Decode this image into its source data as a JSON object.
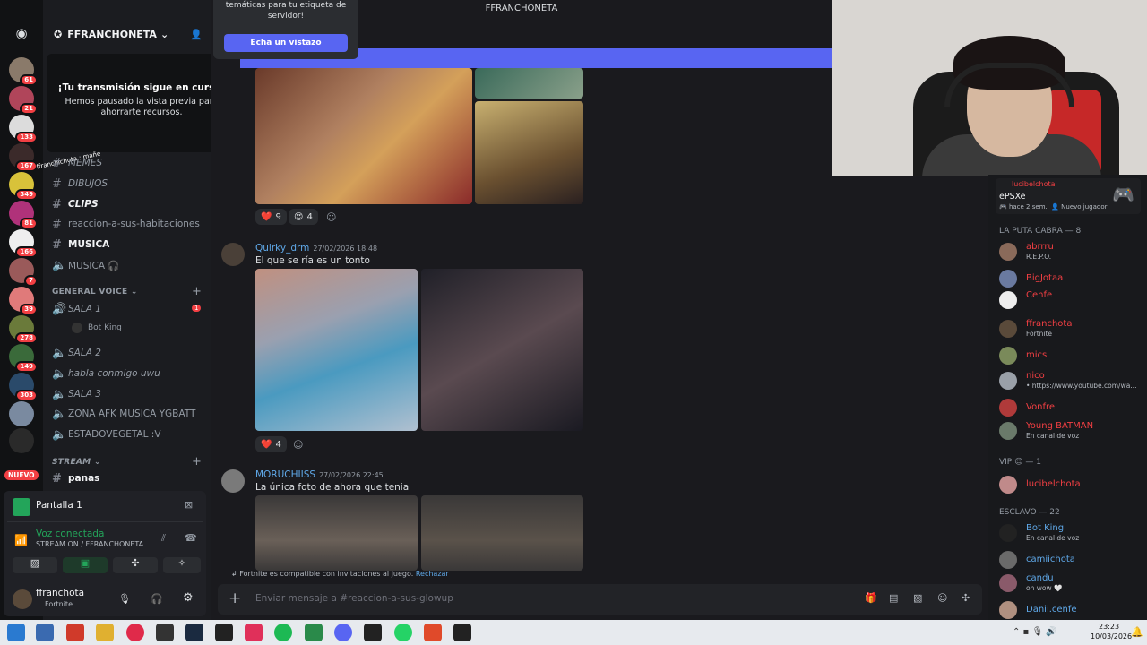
{
  "window": {
    "title": "FFRANCHONETA"
  },
  "server": {
    "name": "FFRANCHONETA"
  },
  "rail_badges": [
    "61",
    "21",
    "133",
    "167",
    "349",
    "81",
    "166",
    "7",
    "39",
    "278",
    "149",
    "303"
  ],
  "rail_new_label": "NUEVO",
  "notice": {
    "title": "¡Tu transmisión sigue en curso!",
    "body": "Hemos pausado la vista previa para ahorrarte recursos."
  },
  "popup": {
    "text": "temáticas para tu etiqueta de servidor!",
    "button": "Echa un vistazo"
  },
  "overlay_text": "ffranchichota : mañe",
  "channels": {
    "memes": "MEMES",
    "dibujos": "DIBUJOS",
    "clips": "CLIPS",
    "reaccion": "reaccion-a-sus-habitaciones",
    "musica": "MUSICA",
    "musica_voice": "MUSICA 🎧",
    "general_voice": "GENERAL VOICE",
    "sala1": "SALA 1",
    "sala1_badge": "1",
    "botking": "Bot King",
    "sala2": "SALA 2",
    "habla": "habla conmigo uwu",
    "sala3": "SALA 3",
    "afk": "ZONA AFK MUSICA YGBATT",
    "estadovegetal": "ESTADOVEGETAL :V",
    "stream": "STREAM",
    "panas": "panas"
  },
  "voice_panel": {
    "screen_title": "Pantalla 1",
    "status": "Voz conectada",
    "sub": "STREAM ON / FFRANCHONETA",
    "user": "ffranchota",
    "user_status": "Fortnite"
  },
  "messages": [
    {
      "reactions": [
        {
          "emoji": "❤️",
          "count": "9"
        },
        {
          "emoji": "😍",
          "count": "4"
        }
      ]
    },
    {
      "user": "Quirky_drm",
      "time": "27/02/2026 18:48",
      "text": "El que se ría es un tonto",
      "reactions": [
        {
          "emoji": "❤️",
          "count": "4"
        }
      ]
    },
    {
      "user": "MORUCHIISS",
      "time": "27/02/2026 22:45",
      "text": "La única foto de ahora que tenia"
    }
  ],
  "fortnite_note": {
    "text": "Fortnite es compatible con invitaciones al juego.",
    "action": "Rechazar"
  },
  "composer": {
    "placeholder": "Enviar mensaje a #reaccion-a-sus-glowup"
  },
  "members_top": {
    "name": "lucibelchota",
    "game": "ePSXe",
    "sub1": "hace 2 sem.",
    "sub2": "Nuevo jugador"
  },
  "member_groups": [
    {
      "title": "LA PUTA CABRA — 8",
      "members": [
        {
          "name": "abrrru",
          "status": "R.E.P.O."
        },
        {
          "name": "BigJotaa",
          "status": ""
        },
        {
          "name": "Cenfe",
          "status": ""
        },
        {
          "name": "ffranchota",
          "status": "Fortnite"
        },
        {
          "name": "mics",
          "status": ""
        },
        {
          "name": "nico",
          "status": "• https://www.youtube.com/wa..."
        },
        {
          "name": "Vonfre",
          "status": ""
        },
        {
          "name": "Young BATMAN",
          "status": "En canal de voz"
        }
      ]
    },
    {
      "title": "VIP 😍 — 1",
      "members": [
        {
          "name": "lucibelchota",
          "status": ""
        }
      ]
    },
    {
      "title": "ESCLAVO — 22",
      "members": [
        {
          "name": "Bot King",
          "status": "En canal de voz"
        },
        {
          "name": "camiichota",
          "status": ""
        },
        {
          "name": "candu",
          "status": "oh wow 🤍"
        },
        {
          "name": "Danii.cenfe",
          "status": ""
        }
      ]
    }
  ],
  "taskbar": {
    "time": "23:23",
    "date": "10/03/2026"
  },
  "colors": {
    "accent": "#5865f2",
    "danger": "#f23f43",
    "link": "#5fa8e8",
    "online": "#23a55a"
  }
}
